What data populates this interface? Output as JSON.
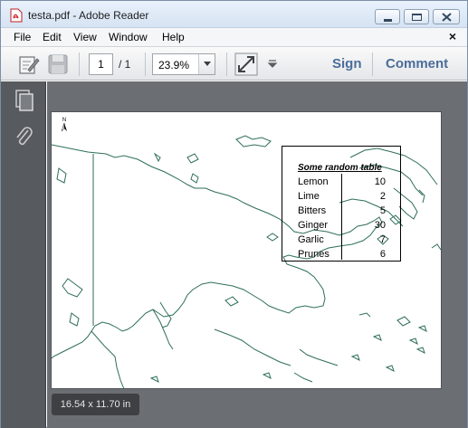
{
  "window": {
    "title": "testa.pdf - Adobe Reader"
  },
  "menu": {
    "items": [
      "File",
      "Edit",
      "View",
      "Window",
      "Help"
    ],
    "close_glyph": "×"
  },
  "toolbar": {
    "page_current": "1",
    "page_total": "/ 1",
    "zoom": "23.9%",
    "sign_label": "Sign",
    "comment_label": "Comment",
    "icons": [
      "edit-pen-icon",
      "save-disk-icon",
      "fit-page-icon",
      "more-arrow-icon"
    ]
  },
  "nav": {
    "icons": [
      "pages-thumbnail-icon",
      "attachments-paperclip-icon"
    ]
  },
  "document": {
    "north_arrow_label": "N",
    "table": {
      "title": "Some random table",
      "rows": [
        {
          "name": "Lemon",
          "value": "10"
        },
        {
          "name": "Lime",
          "value": "2"
        },
        {
          "name": "Bitters",
          "value": "5"
        },
        {
          "name": "Ginger",
          "value": "30"
        },
        {
          "name": "Garlic",
          "value": "7"
        },
        {
          "name": "Prunes",
          "value": "6"
        }
      ]
    },
    "page_size": "16.54 x 11.70 in"
  },
  "colors": {
    "map_outline": "#2e6e5a",
    "nav_panel": "#575a5e",
    "doc_background": "#6b6e72",
    "link_blue": "#4a6d99"
  }
}
